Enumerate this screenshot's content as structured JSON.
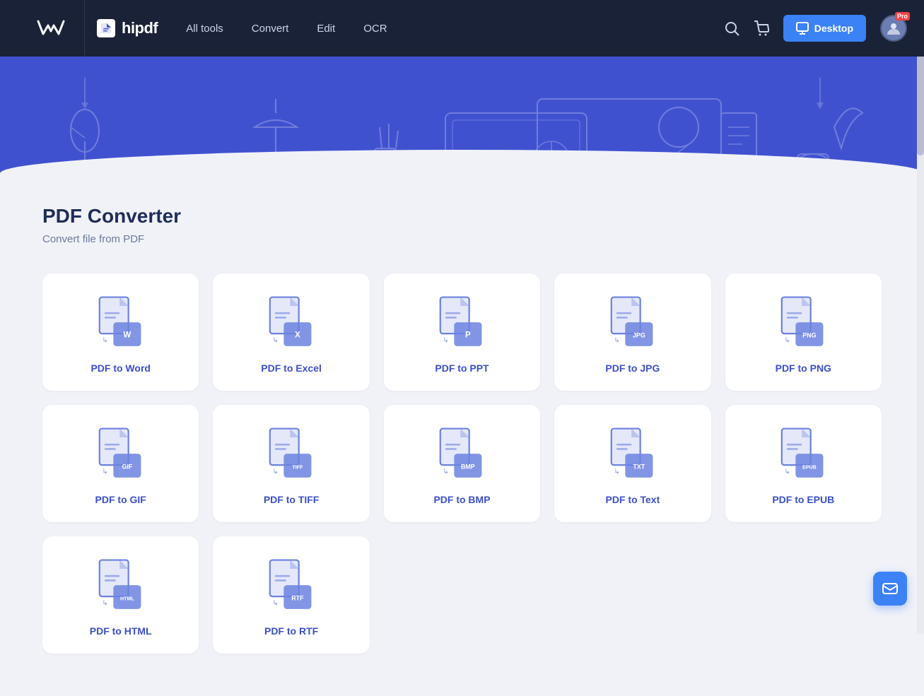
{
  "brand": {
    "wondershare": "Wondershare",
    "hipdf": "hipdf"
  },
  "nav": {
    "links": [
      {
        "label": "All tools",
        "id": "all-tools"
      },
      {
        "label": "Convert",
        "id": "convert"
      },
      {
        "label": "Edit",
        "id": "edit"
      },
      {
        "label": "OCR",
        "id": "ocr"
      }
    ],
    "desktop_button": "Desktop",
    "pro_badge": "Pro"
  },
  "page": {
    "title": "PDF Converter",
    "subtitle": "Convert file from PDF"
  },
  "converters": [
    {
      "id": "pdf-to-word",
      "label": "PDF to Word",
      "ext": "W"
    },
    {
      "id": "pdf-to-excel",
      "label": "PDF to Excel",
      "ext": "X"
    },
    {
      "id": "pdf-to-ppt",
      "label": "PDF to PPT",
      "ext": "P"
    },
    {
      "id": "pdf-to-jpg",
      "label": "PDF to JPG",
      "ext": "JPG"
    },
    {
      "id": "pdf-to-png",
      "label": "PDF to PNG",
      "ext": "PNG"
    },
    {
      "id": "pdf-to-gif",
      "label": "PDF to GIF",
      "ext": "GIF"
    },
    {
      "id": "pdf-to-tiff",
      "label": "PDF to TIFF",
      "ext": "TIFF"
    },
    {
      "id": "pdf-to-bmp",
      "label": "PDF to BMP",
      "ext": "BMP"
    },
    {
      "id": "pdf-to-text",
      "label": "PDF to Text",
      "ext": "TXT"
    },
    {
      "id": "pdf-to-epub",
      "label": "PDF to EPUB",
      "ext": "EPUB"
    },
    {
      "id": "pdf-to-html",
      "label": "PDF to HTML",
      "ext": "HTML"
    },
    {
      "id": "pdf-to-rtf",
      "label": "PDF to RTF",
      "ext": "RTF"
    }
  ],
  "fab": {
    "icon": "✉"
  }
}
